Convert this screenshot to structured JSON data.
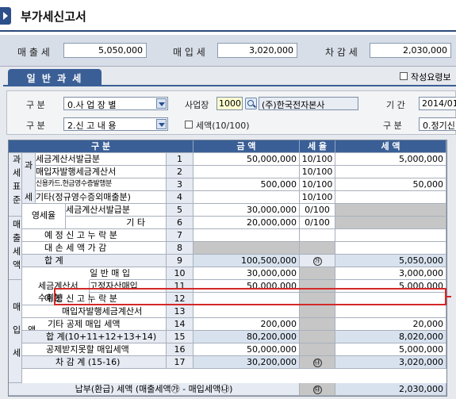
{
  "window": {
    "title": "부가세신고서"
  },
  "summary": {
    "sales_label": "매 출 세",
    "sales_value": "5,050,000",
    "purchase_label": "매 입 세",
    "purchase_value": "3,020,000",
    "diff_label": "차 감 세",
    "diff_value": "2,030,000"
  },
  "tabs": {
    "general": "일 반 과 세"
  },
  "options": {
    "auto_calc_label": "작성요령보"
  },
  "filters": {
    "division_label": "구 분",
    "division_value": "0.사 업 장 별",
    "site_label": "사업장",
    "site_code": "1000",
    "site_name": "(주)한국전자본사",
    "period_label": "기 간",
    "period_value": "2014/01",
    "division2_label": "구 분",
    "division2_value": "2.신 고 내 용",
    "tax_amount_label": "세액(10/100)",
    "division3_label": "구 분",
    "division3_value": "0.정기신"
  },
  "grid": {
    "headers": {
      "division": "구 분",
      "amount": "금 액",
      "rate": "세 율",
      "tax": "세 액"
    },
    "groups": {
      "taxable_standard": "과세표준",
      "sales_tax": "매출세액",
      "purchase_tax": "매입세액",
      "taxable": "과",
      "taxable_tax": "세",
      "zero_rate": "영세율",
      "invoice_received": "세금계산서",
      "invoice_received2": "수취분"
    },
    "rows": [
      {
        "label": "세금계산서발급분",
        "no": "1",
        "amount": "50,000,000",
        "rate": "10/100",
        "tax": "5,000,000"
      },
      {
        "label": "매입자발행세금계산서",
        "no": "2",
        "amount": "",
        "rate": "10/100",
        "tax": ""
      },
      {
        "label": "신용카드.현금영수증발행분",
        "no": "3",
        "amount": "500,000",
        "rate": "10/100",
        "tax": "50,000"
      },
      {
        "label": "기타(정규영수증외매출분)",
        "no": "4",
        "amount": "",
        "rate": "10/100",
        "tax": ""
      },
      {
        "label": "세금계산서발급분",
        "no": "5",
        "amount": "30,000,000",
        "rate": "0/100",
        "tax": ""
      },
      {
        "label": "기 타",
        "no": "6",
        "amount": "20,000,000",
        "rate": "0/100",
        "tax": ""
      },
      {
        "label": "예 정 신 고 누 락 분",
        "no": "7",
        "amount": "",
        "rate": "",
        "tax": ""
      },
      {
        "label": "대 손 세 액 가 감",
        "no": "8",
        "amount": "",
        "rate": "",
        "tax": ""
      },
      {
        "label": "합 계",
        "no": "9",
        "amount": "100,500,000",
        "rate": "㉮",
        "tax": "5,050,000"
      },
      {
        "label": "일 반 매 입",
        "no": "10",
        "amount": "30,000,000",
        "rate": "",
        "tax": "3,000,000"
      },
      {
        "label": "고정자산매입",
        "no": "11",
        "amount": "50,000,000",
        "rate": "",
        "tax": "5,000,000"
      },
      {
        "label": "예 정 신 고 누 락 분",
        "no": "12",
        "amount": "",
        "rate": "",
        "tax": ""
      },
      {
        "label": "매입자발행세금계산서",
        "no": "13",
        "amount": "",
        "rate": "",
        "tax": ""
      },
      {
        "label": "기타 공제 매입 세액",
        "no": "14",
        "amount": "200,000",
        "rate": "",
        "tax": "20,000"
      },
      {
        "label": "합 계(10+11+12+13+14)",
        "no": "15",
        "amount": "80,200,000",
        "rate": "",
        "tax": "8,020,000"
      },
      {
        "label": "공제받지못할 매입세액",
        "no": "16",
        "amount": "50,000,000",
        "rate": "",
        "tax": "5,000,000"
      },
      {
        "label": "차 감 계 (15-16)",
        "no": "17",
        "amount": "30,200,000",
        "rate": "㉯",
        "tax": "3,020,000"
      }
    ],
    "payable": {
      "label": "납부(환급) 세액 (매출세액㉮ - 매입세액㉯)",
      "rate": "㉰",
      "tax": "2,030,000"
    }
  }
}
